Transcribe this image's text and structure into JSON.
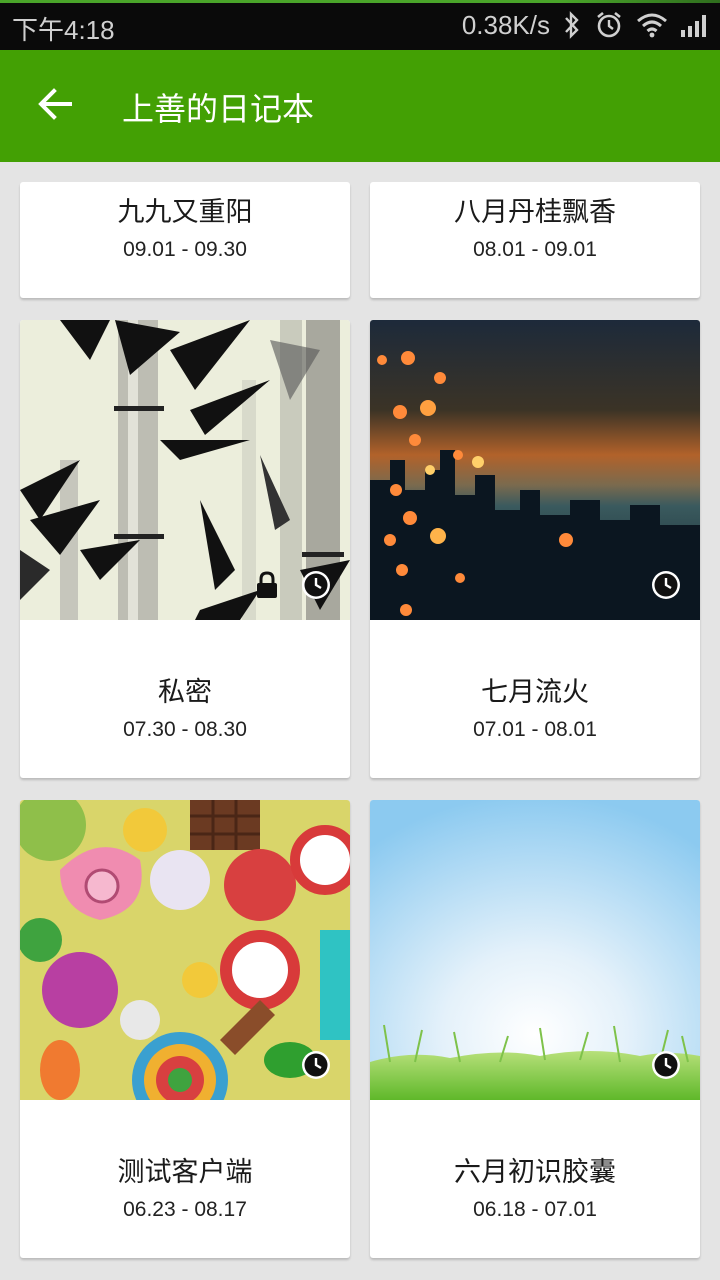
{
  "status_bar": {
    "time": "下午4:18",
    "net_speed": "0.38K/s",
    "icons": [
      "bluetooth-icon",
      "alarm-icon",
      "wifi-icon",
      "signal-icon"
    ]
  },
  "app_bar": {
    "back_icon": "arrow-left-icon",
    "title": "上善的日记本"
  },
  "notebooks": [
    {
      "title": "九九又重阳",
      "dates": "09.01 - 09.30",
      "cover": "none"
    },
    {
      "title": "八月丹桂飘香",
      "dates": "08.01 - 09.01",
      "cover": "none"
    },
    {
      "title": "私密",
      "dates": "07.30 - 08.30",
      "cover": "bamboo-ink-painting",
      "badges": [
        "lock-icon",
        "clock-icon"
      ]
    },
    {
      "title": "七月流火",
      "dates": "07.01 - 08.01",
      "cover": "city-sunset-bokeh",
      "badges": [
        "clock-icon"
      ]
    },
    {
      "title": "测试客户端",
      "dates": "06.23 - 08.17",
      "cover": "candy-pile",
      "badges": [
        "clock-icon"
      ]
    },
    {
      "title": "六月初识胶囊",
      "dates": "06.18 - 07.01",
      "cover": "sky-and-grass",
      "badges": [
        "clock-icon"
      ]
    }
  ],
  "colors": {
    "app_bar": "#43a004",
    "background": "#e4e4e4",
    "card": "#ffffff"
  }
}
